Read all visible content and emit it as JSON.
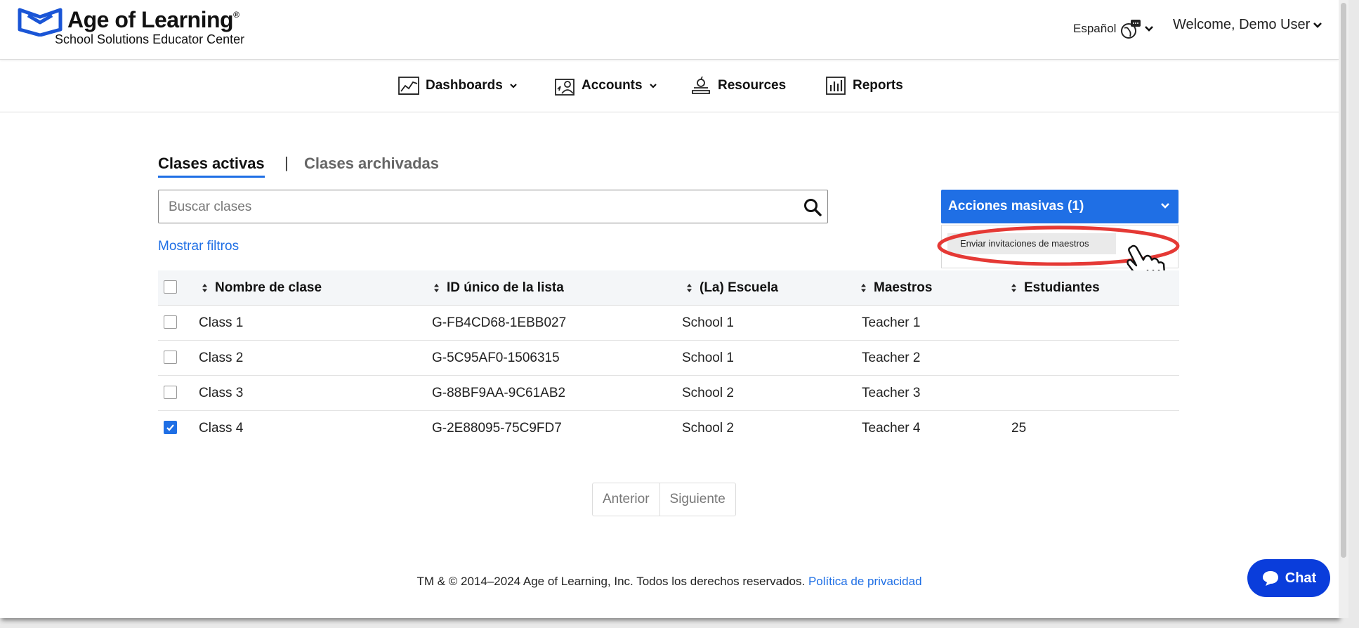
{
  "header": {
    "brand_name": "Age of Learning",
    "brand_reg": "®",
    "brand_subtitle": "School Solutions Educator Center",
    "language_label": "Español",
    "welcome_label": "Welcome, Demo User"
  },
  "nav": {
    "items": [
      {
        "label": "Dashboards",
        "icon": "chart-icon"
      },
      {
        "label": "Accounts",
        "icon": "accounts-icon"
      },
      {
        "label": "Resources",
        "icon": "resources-icon"
      },
      {
        "label": "Reports",
        "icon": "reports-icon"
      }
    ]
  },
  "tabs": {
    "active": "Clases activas",
    "separator": "|",
    "archived": "Clases archivadas"
  },
  "search": {
    "placeholder": "Buscar clases",
    "value": ""
  },
  "bulk_actions": {
    "label": "Acciones masivas (1)",
    "menu_items": [
      "Enviar invitaciones de maestros"
    ]
  },
  "filters": {
    "label": "Mostrar filtros"
  },
  "table": {
    "columns": [
      "Nombre de clase",
      "ID único de la lista",
      "(La) Escuela",
      "Maestros",
      "Estudiantes"
    ],
    "rows": [
      {
        "name": "Class 1",
        "id": "G-FB4CD68-1EBB027",
        "school": "School 1",
        "teacher": "Teacher 1",
        "students": "",
        "checked": false
      },
      {
        "name": "Class 2",
        "id": "G-5C95AF0-1506315",
        "school": "School 1",
        "teacher": "Teacher 2",
        "students": "",
        "checked": false
      },
      {
        "name": "Class 3",
        "id": "G-88BF9AA-9C61AB2",
        "school": "School 2",
        "teacher": "Teacher 3",
        "students": "",
        "checked": false
      },
      {
        "name": "Class 4",
        "id": "G-2E88095-75C9FD7",
        "school": "School 2",
        "teacher": "Teacher 4",
        "students": "25",
        "checked": true
      }
    ]
  },
  "pagination": {
    "prev": "Anterior",
    "next": "Siguiente"
  },
  "footer": {
    "copyright": "TM & © 2014–2024 Age of Learning, Inc. Todos los derechos reservados.",
    "privacy": "Política de privacidad"
  },
  "chat": {
    "label": "Chat"
  },
  "colors": {
    "accent": "#1f6fe5",
    "chat": "#0a3ddb",
    "highlight": "#e53935"
  }
}
